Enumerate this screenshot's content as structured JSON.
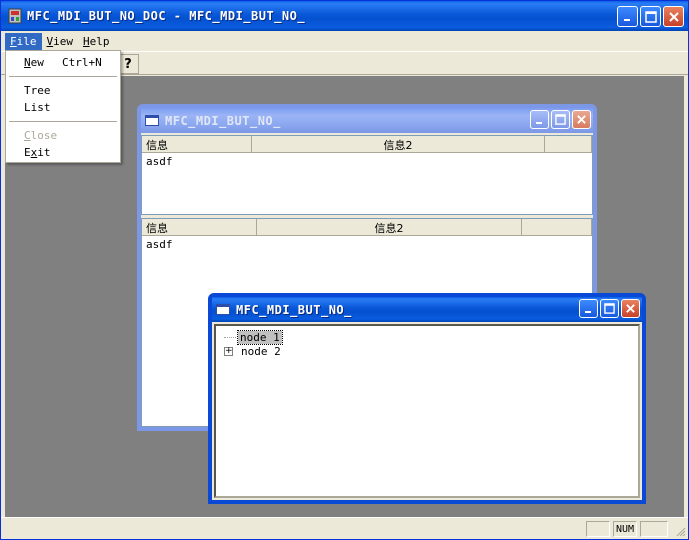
{
  "app": {
    "title": "MFC_MDI_BUT_NO_DOC - MFC_MDI_BUT_NO_"
  },
  "menubar": {
    "items": [
      {
        "label": "File",
        "mnemonic": "F",
        "rest": "ile"
      },
      {
        "label": "View",
        "mnemonic": "V",
        "rest": "iew"
      },
      {
        "label": "Help",
        "mnemonic": "H",
        "rest": "elp"
      }
    ]
  },
  "file_menu": {
    "new": {
      "mnemonic": "N",
      "rest": "ew",
      "accel": "Ctrl+N"
    },
    "tree": "Tree",
    "list": "List",
    "close": {
      "mnemonic": "C",
      "rest": "lose"
    },
    "exit": {
      "pre": "E",
      "mnemonic": "x",
      "rest": "it"
    }
  },
  "toolbar": {
    "help_glyph": "?"
  },
  "child_list": {
    "title": "MFC_MDI_BUT_NO_",
    "top_pane": {
      "columns": [
        "信息",
        "信息2"
      ],
      "rows": [
        [
          "asdf",
          ""
        ]
      ]
    },
    "bottom_pane": {
      "columns": [
        "信息",
        "信息2"
      ],
      "rows": [
        [
          "asdf",
          ""
        ]
      ]
    }
  },
  "child_tree": {
    "title": "MFC_MDI_BUT_NO_",
    "nodes": [
      {
        "label": "node 1",
        "selected": true,
        "expandable": false
      },
      {
        "label": "node 2",
        "selected": false,
        "expandable": true
      }
    ]
  },
  "statusbar": {
    "num": "NUM"
  },
  "colors": {
    "title_active": "#0a5ce0",
    "title_inactive": "#8aa6ee",
    "mdi_background": "#808080",
    "menu_highlight": "#316ac5"
  }
}
